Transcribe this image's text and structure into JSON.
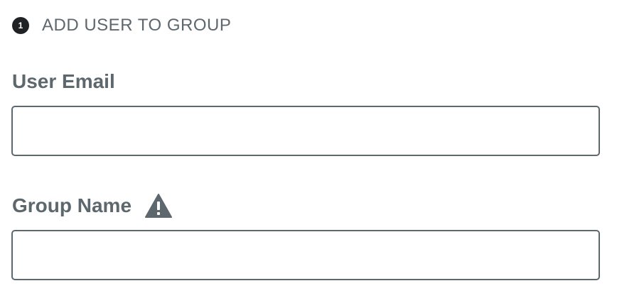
{
  "step": {
    "number": "1",
    "title": "ADD USER TO GROUP"
  },
  "fields": {
    "user_email": {
      "label": "User Email",
      "value": "",
      "placeholder": ""
    },
    "group_name": {
      "label": "Group Name",
      "value": "",
      "placeholder": "",
      "icon": "warning-icon"
    }
  },
  "colors": {
    "text": "#5d676e",
    "badge": "#1f2326",
    "border": "#5d676e"
  }
}
